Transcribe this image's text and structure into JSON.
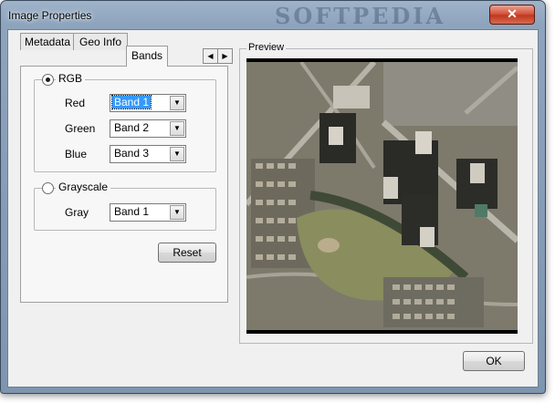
{
  "window": {
    "title": "Image Properties",
    "watermark": "SOFTPEDIA",
    "close_glyph": "✕"
  },
  "tabs": [
    {
      "label": "Metadata",
      "active": false
    },
    {
      "label": "Geo Info",
      "active": false
    },
    {
      "label": "Bands",
      "active": true
    }
  ],
  "tab_scroll": {
    "left_glyph": "◀",
    "right_glyph": "▶"
  },
  "rgb": {
    "label": "RGB",
    "selected": true,
    "red": {
      "label": "Red",
      "value": "Band 1"
    },
    "green": {
      "label": "Green",
      "value": "Band 2"
    },
    "blue": {
      "label": "Blue",
      "value": "Band 3"
    }
  },
  "grayscale": {
    "label": "Grayscale",
    "selected": false,
    "gray": {
      "label": "Gray",
      "value": "Band 1"
    }
  },
  "reset_label": "Reset",
  "preview": {
    "label": "Preview"
  },
  "ok_label": "OK",
  "icons": {
    "combo_arrow": "▼"
  },
  "colors": {
    "selection": "#3399ff",
    "close_button": "#c8442a"
  }
}
